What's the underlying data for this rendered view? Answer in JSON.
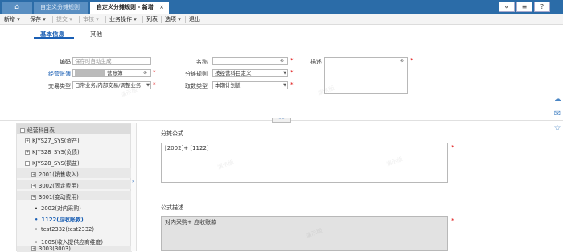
{
  "tabs": {
    "home_icon": "home-icon",
    "tab1": "自定义分摊规则",
    "tab2": "自定义分摊规则 - 新增",
    "tab2_close": "×"
  },
  "topright": {
    "collapse_glyph": "«",
    "list_glyph": "≡",
    "help_glyph": "?"
  },
  "menu": {
    "items": [
      {
        "label": "新增 ▾"
      },
      {
        "label": "保存 ▾"
      },
      {
        "label": "提交 ▾"
      },
      {
        "label": "审核 ▾"
      },
      {
        "label": "业务操作 ▾"
      },
      {
        "label": "列表"
      },
      {
        "label": "选项 ▾"
      },
      {
        "label": "退出"
      }
    ]
  },
  "subtabs": {
    "basic": "基本信息",
    "other": "其他"
  },
  "form": {
    "code_label": "编码",
    "code_placeholder": "保存时自动生成",
    "account_label": "经营账簿",
    "account_value": "营账簿",
    "trade_type_label": "交易类型",
    "trade_type_value": "日常业务/内部交易/调整业务",
    "name_label": "名称",
    "name_value": "",
    "rule_label": "分摊规则",
    "rule_value": "按经营科目定义",
    "fetch_type_label": "取数类型",
    "fetch_type_value": "本期计划值",
    "desc_label": "描述",
    "required_mark": "*"
  },
  "tree": {
    "root": "经营科目表",
    "items": [
      {
        "label": "KJYS27_SYS(资产)"
      },
      {
        "label": "KJYS28_SYS(负债)"
      },
      {
        "label": "KJYS28_SYS(损益)"
      },
      {
        "label": "2001(销售收入)"
      },
      {
        "label": "3002(固定费用)"
      },
      {
        "label": "3001(变动费用)"
      },
      {
        "label": "2002(对内采购)"
      },
      {
        "label": "1122(应收账款)"
      },
      {
        "label": "test2332(test2332)"
      },
      {
        "label": "1005(收入提供应商维度)"
      },
      {
        "label": "3003(3003)"
      }
    ]
  },
  "formula": {
    "label": "分摊公式",
    "value": "[2002]+ [1122]"
  },
  "formula_desc": {
    "label": "公式描述",
    "value": "对内采购+ 应收账款"
  },
  "watermark": "演示版",
  "side_icons": [
    "cloud-icon",
    "chat-icon",
    "star-icon"
  ]
}
